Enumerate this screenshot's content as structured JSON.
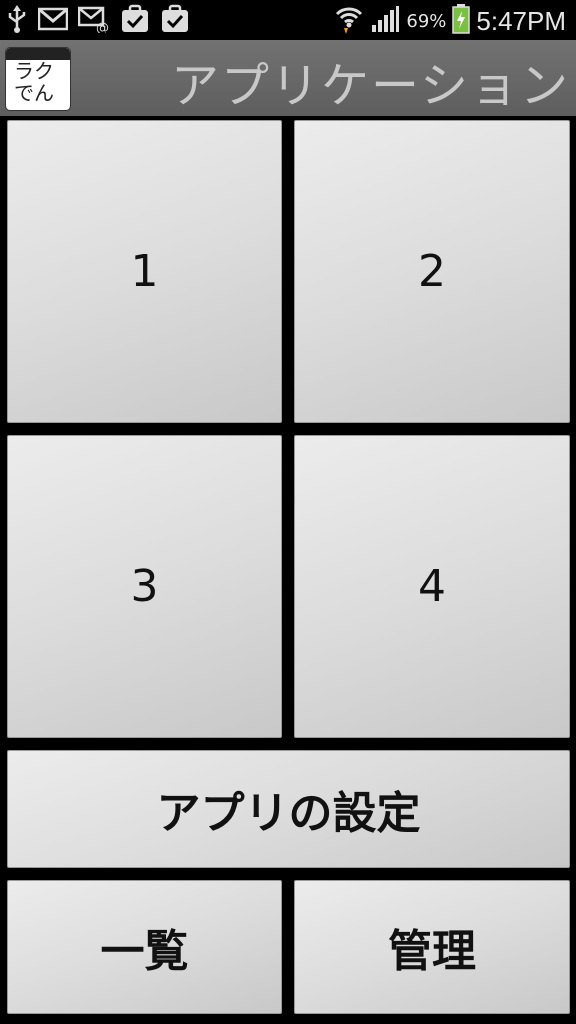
{
  "status_bar": {
    "icons_left": [
      "usb-icon",
      "gmail-icon",
      "email-icon",
      "task-check-icon",
      "task-check-icon"
    ],
    "icons_right": [
      "wifi-icon",
      "signal-icon",
      "battery-icon"
    ],
    "battery_percent": "69%",
    "time": "5:47PM"
  },
  "header": {
    "app_icon_text_line1": "ラク",
    "app_icon_text_line2": "でん",
    "title": "アプリケーション"
  },
  "grid": {
    "buttons": [
      {
        "label": "1"
      },
      {
        "label": "2"
      },
      {
        "label": "3"
      },
      {
        "label": "4"
      }
    ]
  },
  "bottom": {
    "settings_label": "アプリの設定",
    "list_label": "一覧",
    "manage_label": "管理"
  },
  "colors": {
    "status_bg": "#000000",
    "title_bg": "#666666",
    "button_bg": "#dcdcdc",
    "battery_green": "#7ac142"
  }
}
